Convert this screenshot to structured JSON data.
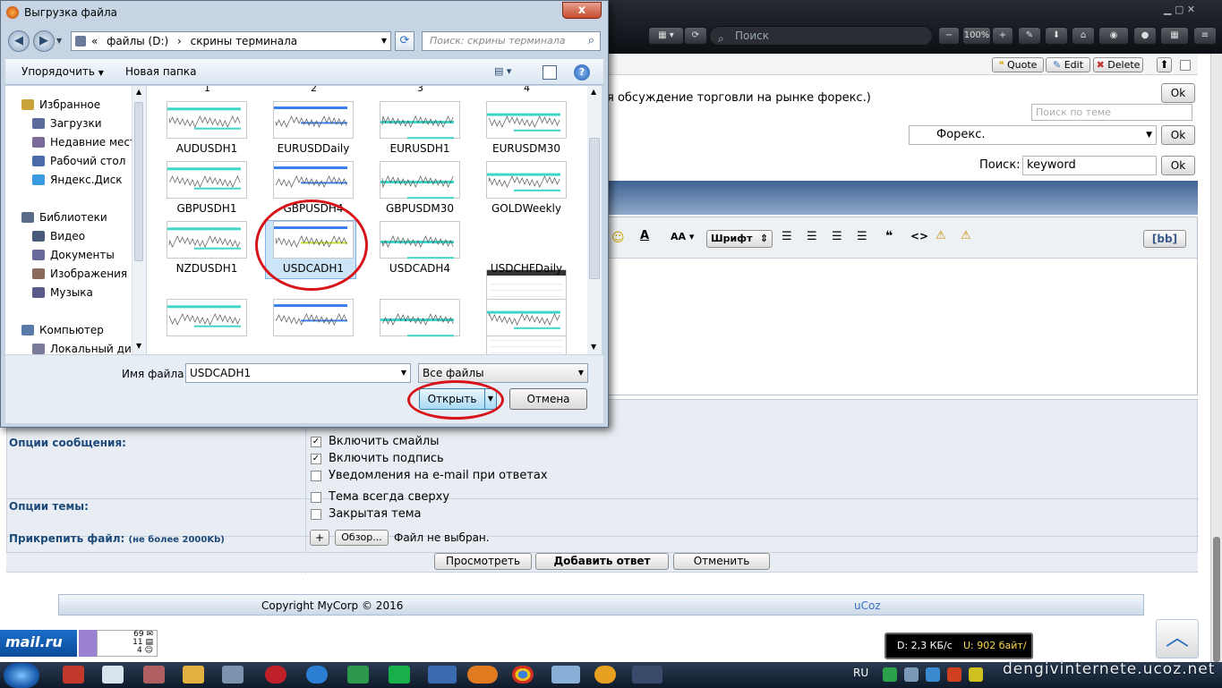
{
  "browser": {
    "search_placeholder": "Поиск",
    "zoom": "100%"
  },
  "forum": {
    "post_buttons": [
      "Quote",
      "Edit",
      "Delete"
    ],
    "description_tail": "я обсуждение торговли на рынке форекс.)",
    "ok_label": "Ok",
    "topic_search_placeholder": "Поиск по теме",
    "forum_select_value": "Форекс.",
    "search_label": "Поиск:",
    "search_value": "keyword",
    "editor": {
      "font_label": "Шрифт",
      "bb_label": "[bb]"
    },
    "message_options_label": "Опции сообщения:",
    "message_options": [
      {
        "label": "Включить смайлы",
        "checked": true
      },
      {
        "label": "Включить подпись",
        "checked": true
      },
      {
        "label": "Уведомления на e-mail при ответах",
        "checked": false
      }
    ],
    "topic_options_label": "Опции темы:",
    "topic_options": [
      {
        "label": "Тема всегда сверху",
        "checked": false
      },
      {
        "label": "Закрытая тема",
        "checked": false
      }
    ],
    "attach_label": "Прикрепить файл:",
    "attach_note": "(не более 2000Kb)",
    "attach_plus": "+",
    "browse_label": "Обзор...",
    "no_file_label": "Файл не выбран.",
    "preview_label": "Просмотреть",
    "add_reply_label": "Добавить ответ",
    "cancel_label": "Отменить",
    "copyright": "Copyright MyCorp © 2016",
    "ucoz": "uCoz"
  },
  "mailru": {
    "logo": "mail.ru",
    "count1": "69",
    "count2": "11",
    "count3": "4"
  },
  "net_meter": {
    "down": "D: 2,3 КБ/с",
    "up": "U: 902 байт/с",
    "down_color": "#ffffff",
    "up_color": "#ffd84a"
  },
  "taskbar": {
    "lang": "RU",
    "watermark": "dengivinternete.ucoz.net"
  },
  "dialog": {
    "title": "Выгрузка файла",
    "close_label": "x",
    "address": {
      "chevrons": "«",
      "drive": "файлы (D:)",
      "sep": "›",
      "folder": "скрины терминала"
    },
    "search_placeholder": "Поиск: скрины терминала",
    "toolbar": {
      "organize": "Упорядочить",
      "new_folder": "Новая папка"
    },
    "nav": [
      {
        "label": "Избранное",
        "icon": "star-icon",
        "color": "#c9a23a"
      },
      {
        "label": "Загрузки",
        "icon": "downloads-icon",
        "color": "#5a6a9a"
      },
      {
        "label": "Недавние места",
        "icon": "recent-icon",
        "color": "#7a6a9a"
      },
      {
        "label": "Рабочий стол",
        "icon": "desktop-icon",
        "color": "#4a6aaa"
      },
      {
        "label": "Яндекс.Диск",
        "icon": "yandex-disk-icon",
        "color": "#3a9ae0"
      },
      {
        "label": "Библиотеки",
        "icon": "libraries-icon",
        "color": "#5a6a8a"
      },
      {
        "label": "Видео",
        "icon": "video-icon",
        "color": "#4a5a7a"
      },
      {
        "label": "Документы",
        "icon": "documents-icon",
        "color": "#6a6a9a"
      },
      {
        "label": "Изображения",
        "icon": "images-icon",
        "color": "#8a6a5a"
      },
      {
        "label": "Музыка",
        "icon": "music-icon",
        "color": "#5a5a8a"
      },
      {
        "label": "Компьютер",
        "icon": "computer-icon",
        "color": "#5a7aaa"
      },
      {
        "label": "Локальный диск",
        "icon": "disk-icon",
        "color": "#7a7a9a"
      }
    ],
    "columns": [
      "1",
      "2",
      "3",
      "4"
    ],
    "files": [
      {
        "name": "AUDUSDH1"
      },
      {
        "name": "EURUSDDaily"
      },
      {
        "name": "EURUSDH1"
      },
      {
        "name": "EURUSDM30"
      },
      {
        "name": "GBPUSDH1"
      },
      {
        "name": "GBPUSDH4"
      },
      {
        "name": "GBPUSDM30"
      },
      {
        "name": "GOLDWeekly"
      },
      {
        "name": "NZDUSDH1"
      },
      {
        "name": "USDCADH1",
        "selected": true
      },
      {
        "name": "USDCADH4"
      },
      {
        "name": "USDCHFDaily"
      },
      {
        "name": ""
      },
      {
        "name": ""
      },
      {
        "name": ""
      },
      {
        "name": ""
      }
    ],
    "filename_label": "Имя файла:",
    "filename_value": "USDCADH1",
    "filetype_value": "Все файлы",
    "open_label": "Открыть",
    "cancel_label": "Отмена",
    "annotation_color": "#d8141b"
  }
}
